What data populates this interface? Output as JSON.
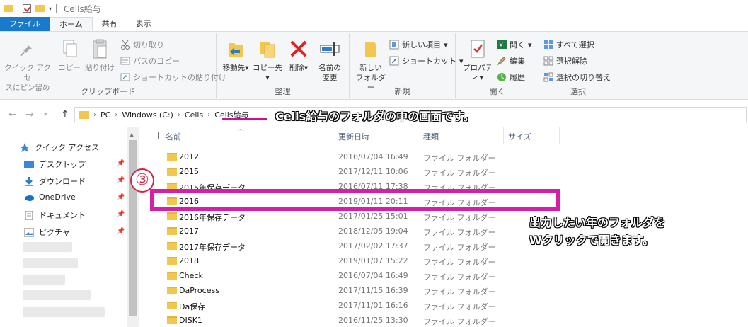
{
  "window": {
    "title": "Cells給与"
  },
  "tabs": [
    "ファイル",
    "ホーム",
    "共有",
    "表示"
  ],
  "ribbon": {
    "clipboard": {
      "pin_label": "クイック アクセ\nスにピン留め",
      "copy_label": "コピー",
      "paste_label": "貼り付け",
      "cut_label": "切り取り",
      "copy_path_label": "パスのコピー",
      "paste_shortcut_label": "ショートカットの貼り付け",
      "group_label": "クリップボード"
    },
    "organize": {
      "move_label": "移動先",
      "copy_to_label": "コピー先",
      "delete_label": "削除",
      "rename_label": "名前の\n変更",
      "group_label": "整理"
    },
    "new": {
      "new_folder_label": "新しい\nフォルダー",
      "new_item_label": "新しい項目",
      "shortcut_label": "ショートカット",
      "group_label": "新規"
    },
    "open": {
      "properties_label": "プロパティ",
      "open_label": "開く",
      "edit_label": "編集",
      "history_label": "履歴",
      "group_label": "開く"
    },
    "select": {
      "select_all_label": "すべて選択",
      "select_none_label": "選択解除",
      "invert_label": "選択の切り替え",
      "group_label": "選択"
    }
  },
  "address": {
    "crumbs": [
      "PC",
      "Windows (C:)",
      "Cells",
      "Cells給与"
    ]
  },
  "nav": {
    "quick_access": "クイック アクセス",
    "items": [
      "デスクトップ",
      "ダウンロード",
      "OneDrive",
      "ドキュメント",
      "ピクチャ"
    ]
  },
  "columns": {
    "name": "名前",
    "date": "更新日時",
    "type": "種類",
    "size": "サイズ"
  },
  "files": [
    {
      "name": "2012",
      "date": "2016/07/04 16:49",
      "type": "ファイル フォルダー"
    },
    {
      "name": "2015",
      "date": "2017/12/11 10:06",
      "type": "ファイル フォルダー"
    },
    {
      "name": "2015年保存データ",
      "date": "2016/07/11 17:38",
      "type": "ファイル フォルダー"
    },
    {
      "name": "2016",
      "date": "2019/01/11 20:11",
      "type": "ファイル フォルダー"
    },
    {
      "name": "2016年保存データ",
      "date": "2017/01/25 15:01",
      "type": "ファイル フォルダー"
    },
    {
      "name": "2017",
      "date": "2018/12/05 19:04",
      "type": "ファイル フォルダー"
    },
    {
      "name": "2017年保存データ",
      "date": "2017/02/02 17:37",
      "type": "ファイル フォルダー"
    },
    {
      "name": "2018",
      "date": "2019/01/07 15:22",
      "type": "ファイル フォルダー"
    },
    {
      "name": "Check",
      "date": "2016/07/04 16:49",
      "type": "ファイル フォルダー"
    },
    {
      "name": "DaProcess",
      "date": "2017/11/15 16:39",
      "type": "ファイル フォルダー"
    },
    {
      "name": "Da保存",
      "date": "2017/11/01 16:16",
      "type": "ファイル フォルダー"
    },
    {
      "name": "DISK1",
      "date": "2016/11/25 13:30",
      "type": "ファイル フォルダー"
    }
  ],
  "annotations": {
    "breadcrumb_note": "Cells給与のフォルダの中の画面です。",
    "step_number": "③",
    "instruction_line1": "出力したい年のフォルダを",
    "instruction_line2": "Wクリックで開きます。"
  },
  "colors": {
    "file_tab": "#1979ca",
    "highlight": "#d61fa8",
    "folder": "#f3c64e"
  }
}
